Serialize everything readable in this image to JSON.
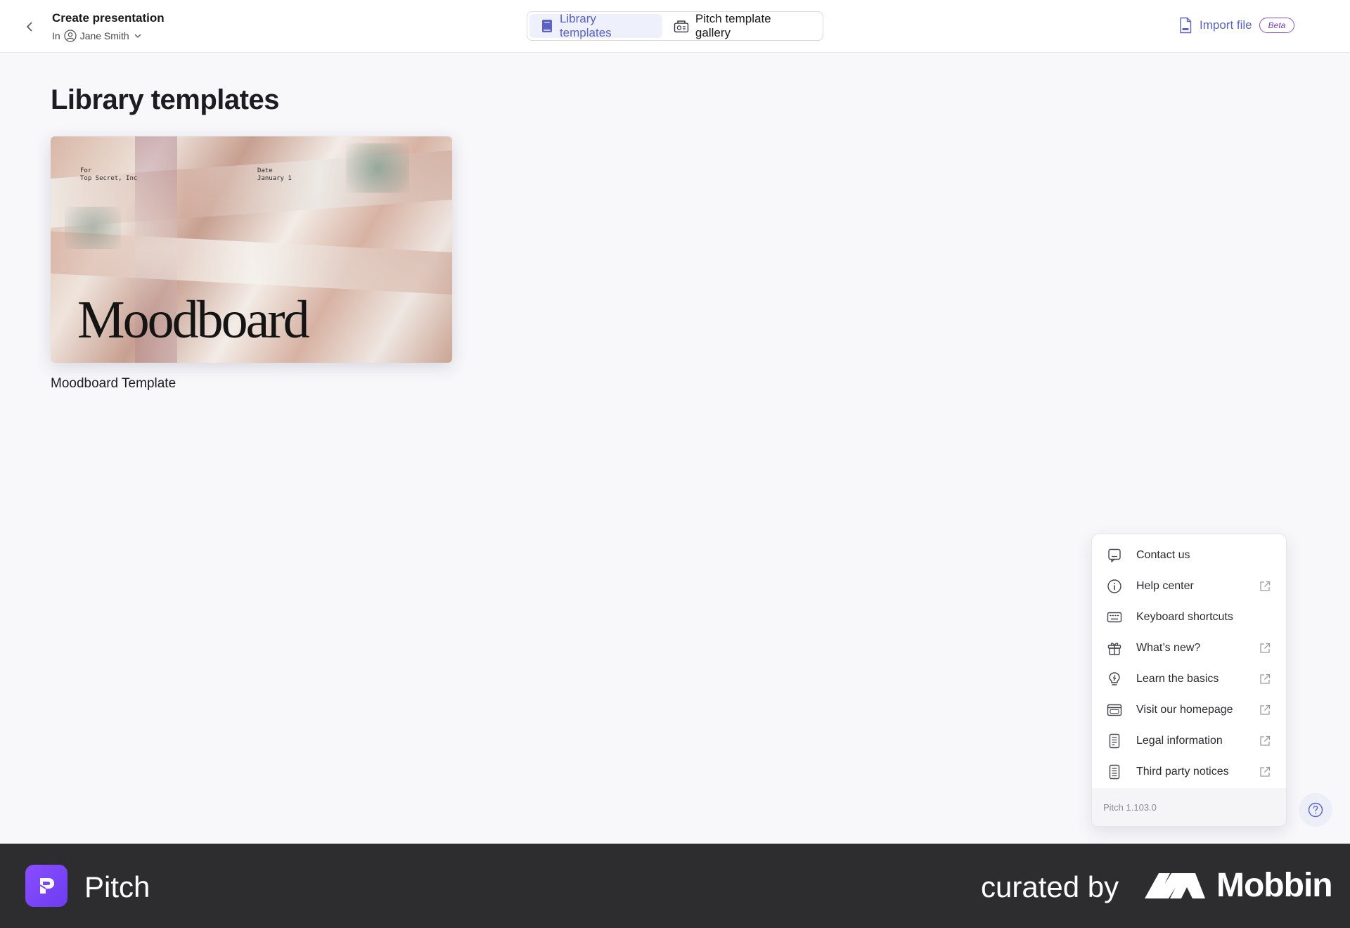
{
  "header": {
    "title": "Create presentation",
    "owner_prefix": "In",
    "owner_name": "Jane Smith",
    "tabs": [
      {
        "label": "Library templates",
        "active": true
      },
      {
        "label": "Pitch template gallery",
        "active": false
      }
    ],
    "import_label": "Import file",
    "beta_label": "Beta"
  },
  "main": {
    "title": "Library templates",
    "templates": [
      {
        "name": "Moodboard Template",
        "preview": {
          "for_label": "For",
          "for_value": "Top Secret, Inc",
          "date_label": "Date",
          "date_value": "January 1",
          "word": "Moodboard"
        }
      }
    ]
  },
  "help_menu": {
    "items": [
      {
        "label": "Contact us",
        "icon": "chat-icon",
        "external": false
      },
      {
        "label": "Help center",
        "icon": "info-icon",
        "external": true
      },
      {
        "label": "Keyboard shortcuts",
        "icon": "keyboard-icon",
        "external": false
      },
      {
        "label": "What’s new?",
        "icon": "gift-icon",
        "external": true
      },
      {
        "label": "Learn the basics",
        "icon": "lightbulb-icon",
        "external": true
      },
      {
        "label": "Visit our homepage",
        "icon": "browser-icon",
        "external": true
      },
      {
        "label": "Legal information",
        "icon": "document-icon",
        "external": true
      },
      {
        "label": "Third party notices",
        "icon": "document-icon",
        "external": true
      }
    ],
    "version": "Pitch 1.103.0"
  },
  "brand": {
    "app_name": "Pitch",
    "curated_by": "curated by",
    "curator": "Mobbin"
  },
  "colors": {
    "accent": "#5a62c4",
    "beta": "#8a4fd6",
    "brandbar": "#2d2d2f",
    "pitch_purple": "#7a45f8"
  }
}
